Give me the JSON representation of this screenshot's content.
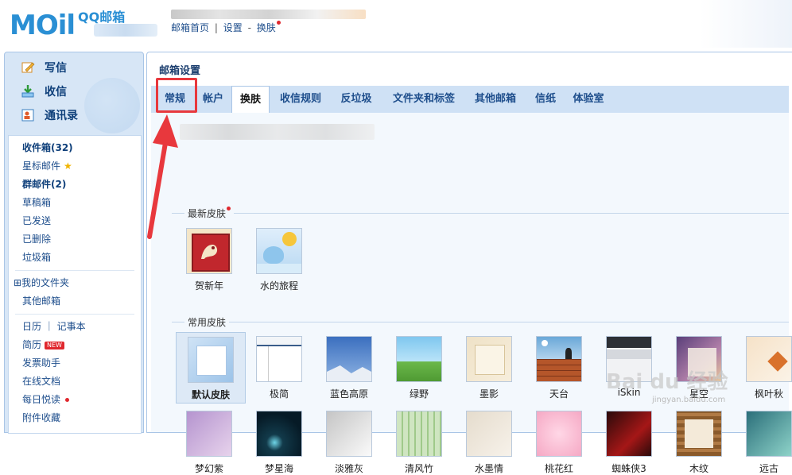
{
  "header": {
    "logo_text": "MOil",
    "logo_sub": "QQ邮箱",
    "links": [
      "邮箱首页",
      "设置",
      "换肤"
    ],
    "link_seps": [
      "|",
      "-"
    ]
  },
  "left": {
    "actions": [
      {
        "label": "写信",
        "icon": "compose-icon"
      },
      {
        "label": "收信",
        "icon": "inbox-download-icon"
      },
      {
        "label": "通讯录",
        "icon": "contacts-icon"
      }
    ],
    "folders_group1": [
      {
        "label": "收件箱(32)",
        "bold": true
      },
      {
        "label": "星标邮件",
        "star": true
      },
      {
        "label": "群邮件(2)",
        "bold": true
      },
      {
        "label": "草稿箱"
      },
      {
        "label": "已发送"
      },
      {
        "label": "已删除"
      },
      {
        "label": "垃圾箱"
      }
    ],
    "folders_group2": [
      {
        "label": "⊞我的文件夹"
      },
      {
        "label": "其他邮箱"
      }
    ],
    "folders_group3": [
      {
        "label": "日历 ｜ 记事本"
      },
      {
        "label": "简历",
        "badge": "NEW"
      },
      {
        "label": "发票助手"
      },
      {
        "label": "在线文档"
      },
      {
        "label": "每日悦读",
        "dot": true
      },
      {
        "label": "附件收藏"
      }
    ]
  },
  "main": {
    "title": "邮箱设置",
    "tabs": [
      "常规",
      "帐户",
      "换肤",
      "收信规则",
      "反垃圾",
      "文件夹和标签",
      "其他邮箱",
      "信纸",
      "体验室"
    ],
    "active_tab": "换肤",
    "sections": [
      {
        "title": "最新皮肤",
        "skins": [
          "贺新年",
          "水的旅程"
        ]
      },
      {
        "title": "常用皮肤",
        "skins": [
          "默认皮肤",
          "极简",
          "蓝色高原",
          "绿野",
          "墨影",
          "天台",
          "iSkin",
          "星空",
          "枫叶秋"
        ]
      },
      {
        "title": "",
        "skins": [
          "梦幻紫",
          "梦星海",
          "淡雅灰",
          "清风竹",
          "水墨情",
          "桃花红",
          "蜘蛛侠3",
          "木纹",
          "远古"
        ]
      }
    ],
    "selected_skin": "默认皮肤"
  },
  "watermark": {
    "text": "Bai du 经验",
    "sub": "jingyan.baidu.com"
  },
  "colors": {
    "accent": "#2a8fd4",
    "highlight": "#e8383d",
    "link": "#1e4e8c"
  }
}
